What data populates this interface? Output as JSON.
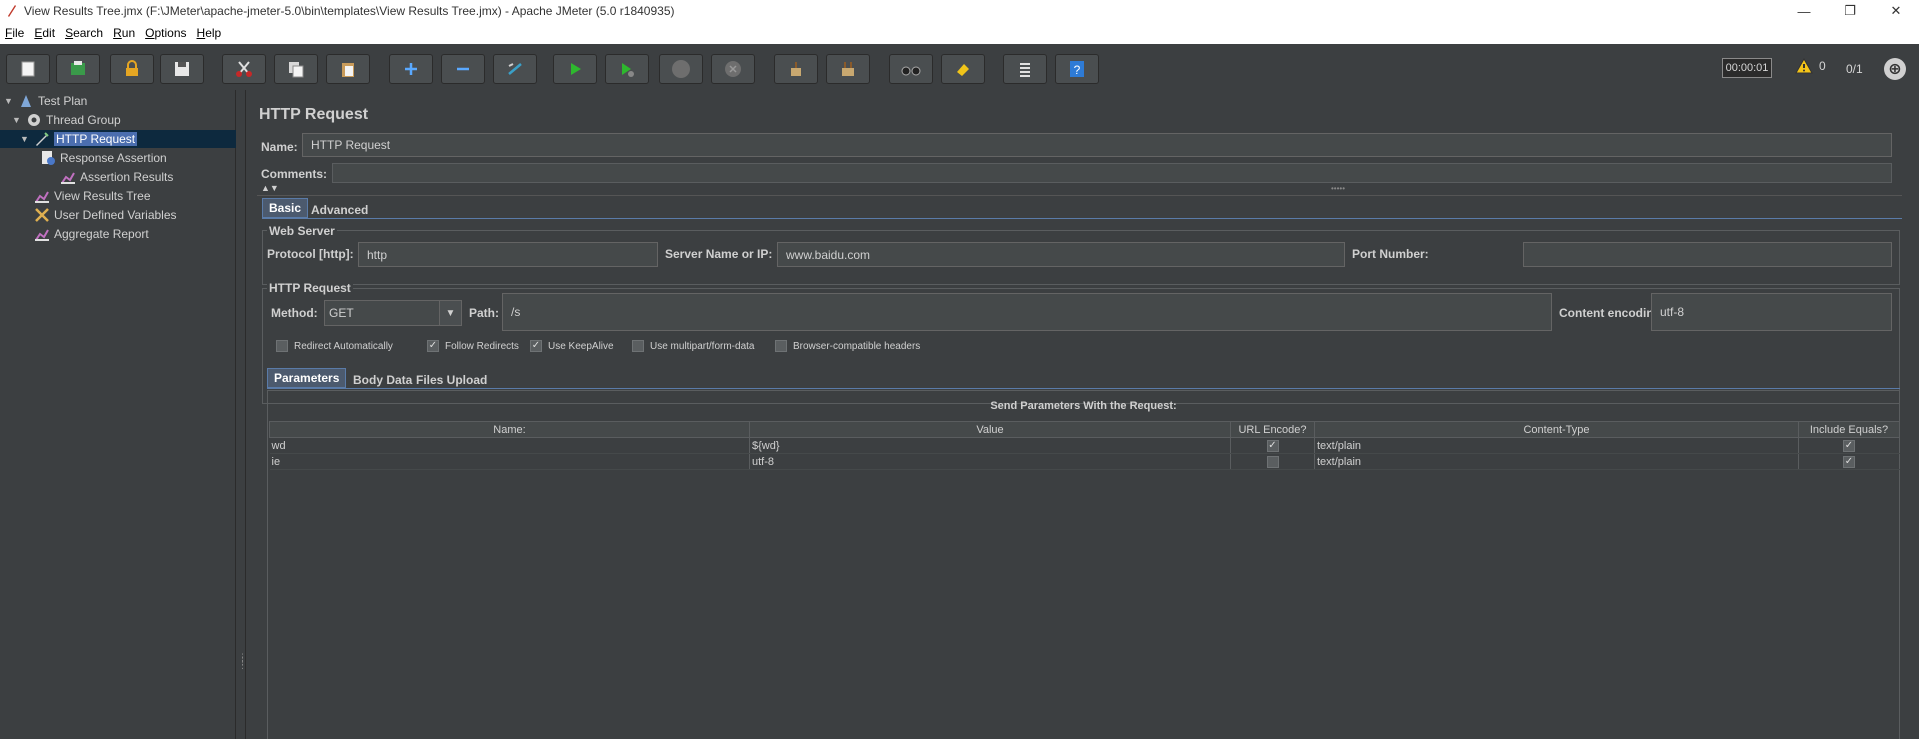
{
  "window": {
    "title": "View Results Tree.jmx (F:\\JMeter\\apache-jmeter-5.0\\bin\\templates\\View Results Tree.jmx) - Apache JMeter (5.0 r1840935)",
    "minimize": "—",
    "restore": "❐",
    "close": "✕"
  },
  "menu": [
    {
      "label": "File",
      "key": "F",
      "rest": "ile"
    },
    {
      "label": "Edit",
      "key": "E",
      "rest": "dit"
    },
    {
      "label": "Search",
      "key": "S",
      "rest": "earch"
    },
    {
      "label": "Run",
      "key": "R",
      "rest": "un"
    },
    {
      "label": "Options",
      "key": "O",
      "rest": "ptions"
    },
    {
      "label": "Help",
      "key": "H",
      "rest": "elp"
    }
  ],
  "status": {
    "timer": "00:00:01",
    "warnings": "0",
    "threads": "0/1"
  },
  "tree": {
    "items": [
      {
        "label": "Test Plan",
        "icon": "test-plan-icon"
      },
      {
        "label": "Thread Group",
        "icon": "gear-icon"
      },
      {
        "label": "HTTP Request",
        "icon": "pen-icon"
      },
      {
        "label": "Response Assertion",
        "icon": "assertion-icon"
      },
      {
        "label": "Assertion Results",
        "icon": "chart-icon"
      },
      {
        "label": "View Results Tree",
        "icon": "chart-icon"
      },
      {
        "label": "User Defined Variables",
        "icon": "tools-icon"
      },
      {
        "label": "Aggregate Report",
        "icon": "chart-icon"
      }
    ]
  },
  "panel": {
    "title": "HTTP Request",
    "name_label": "Name:",
    "name_value": "HTTP Request",
    "comments_label": "Comments:",
    "tabs": {
      "basic": "Basic",
      "advanced": "Advanced"
    },
    "web_server": {
      "legend": "Web Server",
      "protocol_label": "Protocol [http]:",
      "protocol_value": "http",
      "server_label": "Server Name or IP:",
      "server_value": "www.baidu.com",
      "port_label": "Port Number:",
      "port_value": ""
    },
    "http_request": {
      "legend": "HTTP Request",
      "method_label": "Method:",
      "method_value": "GET",
      "path_label": "Path:",
      "path_value": "/s",
      "encoding_label": "Content encoding:",
      "encoding_value": "utf-8"
    },
    "options": [
      {
        "label": "Redirect Automatically",
        "checked": false
      },
      {
        "label": "Follow Redirects",
        "checked": true
      },
      {
        "label": "Use KeepAlive",
        "checked": true
      },
      {
        "label": "Use multipart/form-data",
        "checked": false
      },
      {
        "label": "Browser-compatible headers",
        "checked": false
      }
    ],
    "subtabs": {
      "parameters": "Parameters",
      "body": "Body Data",
      "files": "Files Upload"
    },
    "params": {
      "heading": "Send Parameters With the Request:",
      "columns": [
        "Name:",
        "Value",
        "URL Encode?",
        "Content-Type",
        "Include Equals?"
      ],
      "rows": [
        {
          "name": "wd",
          "value": "${wd}",
          "url_encode": true,
          "content_type": "text/plain",
          "include_equals": true
        },
        {
          "name": "ie",
          "value": "utf-8",
          "url_encode": false,
          "content_type": "text/plain",
          "include_equals": true
        }
      ]
    }
  }
}
